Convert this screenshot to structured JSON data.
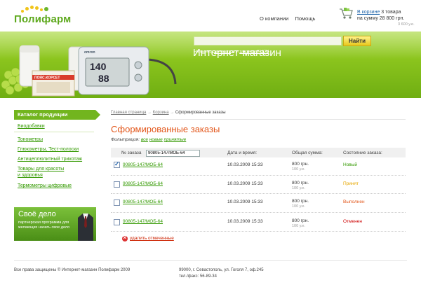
{
  "header": {
    "logo_text": "Полифарм",
    "nav": [
      "О компании",
      "Помощь"
    ],
    "cart": {
      "link": "В корзине",
      "count": "3 товара",
      "sum": "на сумму 28 800 грн.",
      "sum_ue": "3 600 у.е."
    }
  },
  "banner": {
    "title": "Интернет-магазин",
    "search_value": "",
    "search_button": "Найти",
    "hint_prefix": "Например:",
    "hint_ex1": "танометр",
    "hint_mid": "или",
    "hint_ex2": "танометр ELION",
    "product_label": "ПОЯС-КОРСЕТ",
    "device_brand": "omron",
    "device_reading_1": "140",
    "device_reading_2": "88"
  },
  "sidebar": {
    "title": "Каталог продукции",
    "items": [
      {
        "label": "Биодобавки"
      },
      {
        "label": "Тонометры"
      },
      {
        "label": "Глюкометры, Тест-полоски"
      },
      {
        "label": "Антицеллюлитный трикотаж"
      },
      {
        "label": "Товары для красоты"
      },
      {
        "label": "и здоровья"
      },
      {
        "label": "Термометры цифровые"
      }
    ],
    "promo": {
      "title": "Своё дело",
      "text": "партнерская программа для желающих начать свое дело"
    }
  },
  "breadcrumb": {
    "home": "Главная страница",
    "sep": "→",
    "cart": "Корзина",
    "current": "Сформированные заказы"
  },
  "main": {
    "title": "Сформированные заказы",
    "filter_label": "Фильтрация:",
    "filters": [
      "все",
      "новые",
      "принятые"
    ],
    "columns": {
      "number": "№ заказа",
      "date": "Дата и время:",
      "sum": "Общая сумма:",
      "status": "Состояние заказа:"
    },
    "number_input_value": "90805-147/MOБ-64",
    "rows": [
      {
        "order": "90805-147/MOБ-64",
        "datetime": "10.03.2009 15:33",
        "sum": "800 грн.",
        "sum_ue": "100 у.е.",
        "status": "Новый",
        "checked": true
      },
      {
        "order": "90805-147/MOБ-64",
        "datetime": "10.03.2009 15:33",
        "sum": "800 грн.",
        "sum_ue": "100 у.е.",
        "status": "Принят",
        "checked": false
      },
      {
        "order": "90805-147/MOБ-64",
        "datetime": "10.03.2009 15:33",
        "sum": "800 грн.",
        "sum_ue": "100 у.е.",
        "status": "Выполнен",
        "checked": false
      },
      {
        "order": "90805-147/MOБ-64",
        "datetime": "10.03.2009 15:33",
        "sum": "800 грн.",
        "sum_ue": "100 у.е.",
        "status": "Отменен",
        "checked": false
      }
    ],
    "status_colors": {
      "Новый": "#339900",
      "Принят": "#e6a700",
      "Выполнен": "#e2561a",
      "Отменен": "#cc0000"
    },
    "delete_label": "удалить отмеченные"
  },
  "footer": {
    "copyright": "Все права защищены © Интернет-магазин Полифарм 2009",
    "address": "99000, г. Севастополь, ул. Гоголя 7, оф.245",
    "phone": "тел./факс: 56-89-34"
  },
  "colors": {
    "brand_green": "#5ea91d",
    "accent_orange": "#e2561a"
  }
}
